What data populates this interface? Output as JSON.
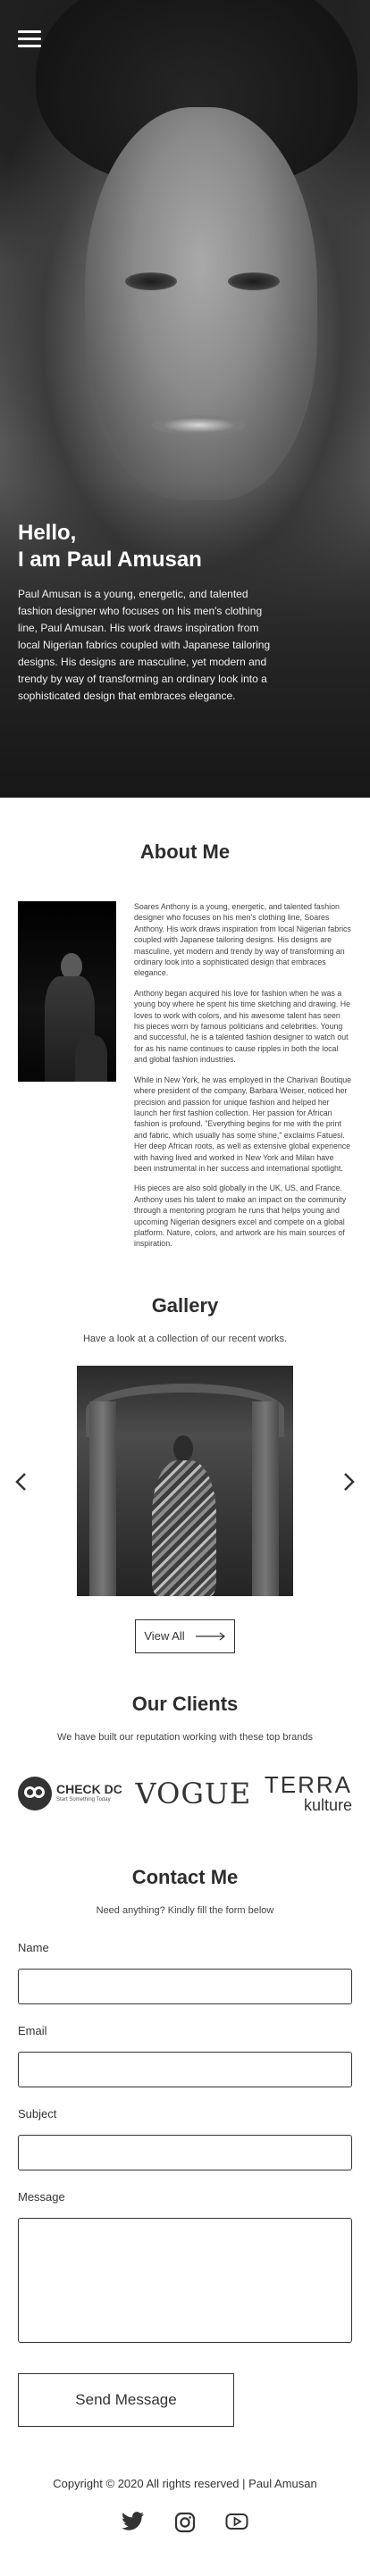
{
  "hero": {
    "title_line1": "Hello,",
    "title_line2": "I am Paul Amusan",
    "description": "Paul Amusan is a young, energetic, and talented fashion designer who focuses on his men's clothing line, Paul Amusan. His work draws inspiration from local Nigerian fabrics coupled with Japanese tailoring designs. His designs are masculine, yet modern and trendy by way of transforming an ordinary look into a sophisticated design that embraces elegance."
  },
  "about": {
    "title": "About Me",
    "paragraphs": [
      "Soares Anthony is a young, energetic, and talented fashion designer who focuses on his men's clothing line, Soares Anthony. His work draws inspiration from local Nigerian fabrics coupled with Japanese tailoring designs. His designs are masculine, yet modern and trendy by way of transforming an ordinary look into a sophisticated design that embraces elegance.",
      "Anthony began acquired his love for fashion when he was a young boy where he spent his time sketching and drawing. He loves to work with colors, and his awesome talent has seen his pieces worn by famous politicians and celebrities. Young and successful, he is a talented fashion designer to watch out for as his name continues to cause ripples in both the local and global fashion industries.",
      "While in New York, he was employed in the Charivari Boutique where president of the company, Barbara Weiser, noticed her precision and passion for unique fashion and helped her launch her first fashion collection. Her passion for African fashion is profound. \"Everything begins for me with the print and fabric, which usually has some shine,\" exclaims Fatuesi. Her deep African roots, as well as extensive global experience with having lived and worked in New York and Milan have been instrumental in her success and international spotlight.",
      "His pieces are also sold globally in the UK, US, and France. Anthony uses his talent to make an impact on the community through a mentoring program he runs that helps young and upcoming Nigerian designers excel and compete on a global platform. Nature, colors, and artwork are his main sources of inspiration."
    ]
  },
  "gallery": {
    "title": "Gallery",
    "subtitle": "Have a look at a collection of our recent works.",
    "view_all_label": "View All"
  },
  "clients": {
    "title": "Our Clients",
    "subtitle": "We have built our reputation working with these top brands",
    "logos": {
      "check_name": "CHECK DC",
      "check_tagline": "Start Something Today",
      "vogue": "VOGUE",
      "terra_line1": "TERRA",
      "terra_line2": "kulture"
    }
  },
  "contact": {
    "title": "Contact Me",
    "subtitle": "Need anything? Kindly fill the form below",
    "fields": {
      "name_label": "Name",
      "email_label": "Email",
      "subject_label": "Subject",
      "message_label": "Message"
    },
    "send_label": "Send Message"
  },
  "footer": {
    "copyright": "Copyright © 2020 All rights reserved | Paul Amusan",
    "socials": [
      "twitter-icon",
      "instagram-icon",
      "youtube-icon"
    ]
  }
}
